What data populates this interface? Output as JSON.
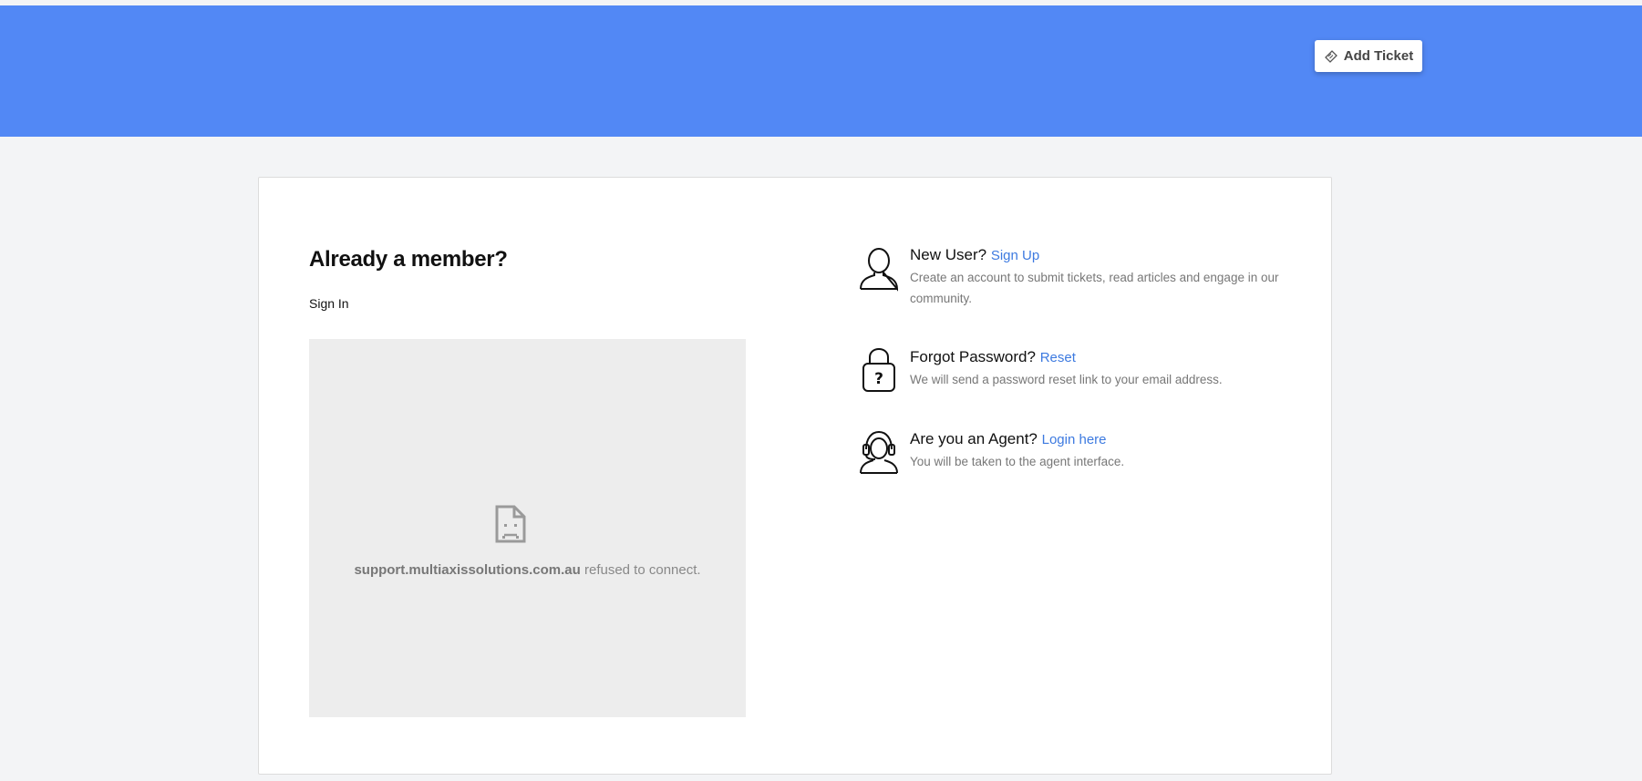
{
  "header": {
    "add_ticket_label": "Add Ticket",
    "icon": "ticket-icon",
    "background": "#5288f5"
  },
  "login": {
    "title": "Already a member?",
    "signin_label": "Sign In",
    "frame": {
      "host": "support.multiaxissolutions.com.au",
      "message": " refused to connect.",
      "icon": "sad-page-icon"
    }
  },
  "options": {
    "new_user": {
      "heading": "New User?",
      "link": "Sign Up",
      "description": "Create an account to submit tickets, read articles and engage in our community.",
      "icon": "user-icon"
    },
    "forgot_password": {
      "heading": "Forgot Password?",
      "link": "Reset",
      "description": "We will send a password reset link to your email address.",
      "icon": "lock-question-icon"
    },
    "agent": {
      "heading": "Are you an Agent?",
      "link": "Login here",
      "description": "You will be taken to the agent interface.",
      "icon": "headset-agent-icon"
    }
  },
  "colors": {
    "accent": "#3d7ae0",
    "page_background": "#f3f4f6"
  }
}
